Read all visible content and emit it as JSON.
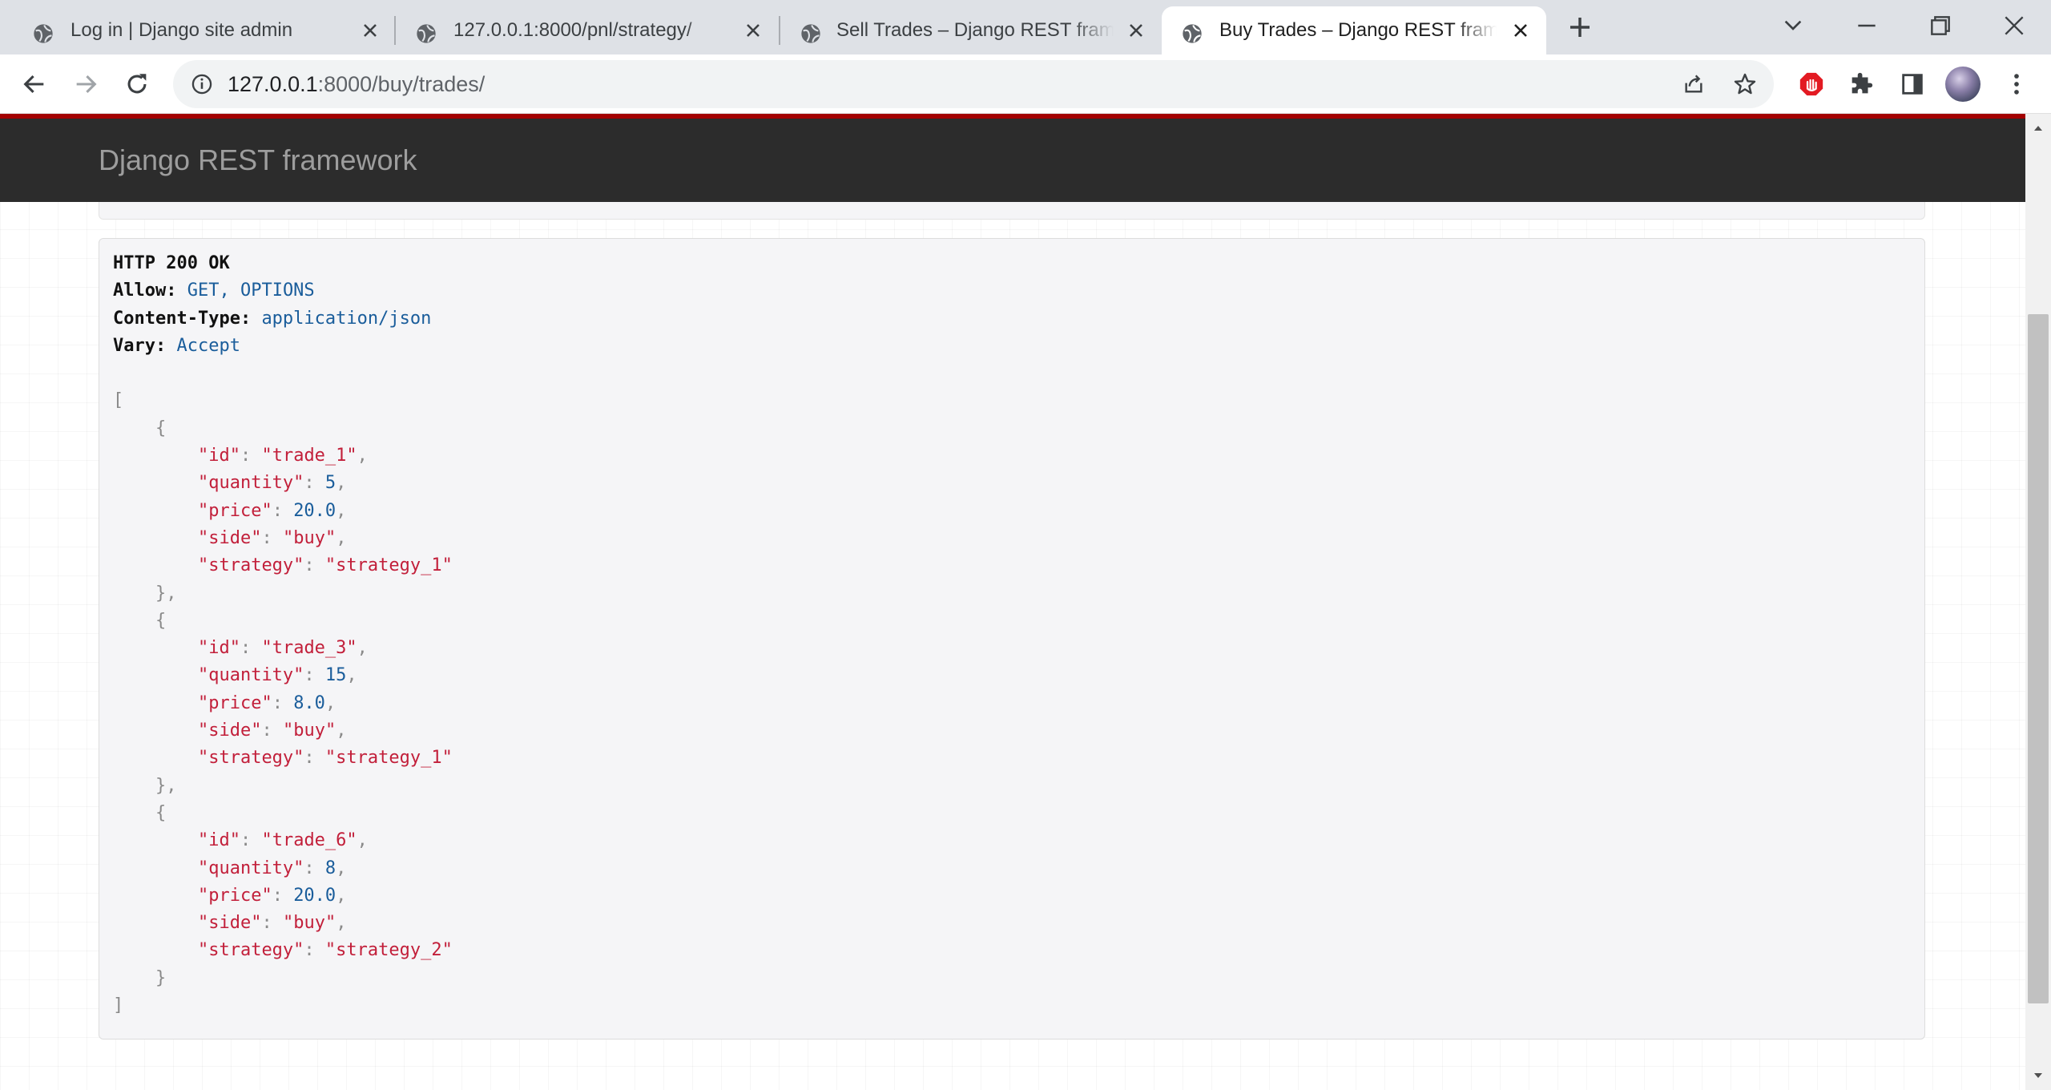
{
  "browser": {
    "tabs": [
      {
        "title": "Log in | Django site admin",
        "active": false
      },
      {
        "title": "127.0.0.1:8000/pnl/strategy/",
        "active": false
      },
      {
        "title": "Sell Trades – Django REST framework",
        "active": false
      },
      {
        "title": "Buy Trades – Django REST framework",
        "active": true
      }
    ],
    "url_host": "127.0.0.1",
    "url_rest": ":8000/buy/trades/",
    "icons": [
      "globe-icon",
      "close-icon",
      "plus-icon",
      "chevron-down-icon",
      "minimize-icon",
      "restore-icon",
      "close-window-icon",
      "back-arrow-icon",
      "forward-arrow-icon",
      "reload-icon",
      "info-icon",
      "share-icon",
      "star-icon",
      "adblock-icon",
      "extensions-icon",
      "sidepanel-icon",
      "profile-avatar",
      "menu-kebab-icon"
    ]
  },
  "page": {
    "brand": "Django REST framework",
    "status_line": "HTTP 200 OK",
    "headers": [
      {
        "name": "Allow:",
        "value": "GET, OPTIONS"
      },
      {
        "name": "Content-Type:",
        "value": "application/json"
      },
      {
        "name": "Vary:",
        "value": "Accept"
      }
    ],
    "trades": [
      {
        "id": "trade_1",
        "quantity": "5",
        "price": "20.0",
        "side": "buy",
        "strategy": "strategy_1"
      },
      {
        "id": "trade_3",
        "quantity": "15",
        "price": "8.0",
        "side": "buy",
        "strategy": "strategy_1"
      },
      {
        "id": "trade_6",
        "quantity": "8",
        "price": "20.0",
        "side": "buy",
        "strategy": "strategy_2"
      }
    ]
  },
  "colors": {
    "navbar": "#2c2c2c",
    "accent_red": "#a30000",
    "json_key": "#c21f3a",
    "json_number": "#1a5d9b"
  }
}
